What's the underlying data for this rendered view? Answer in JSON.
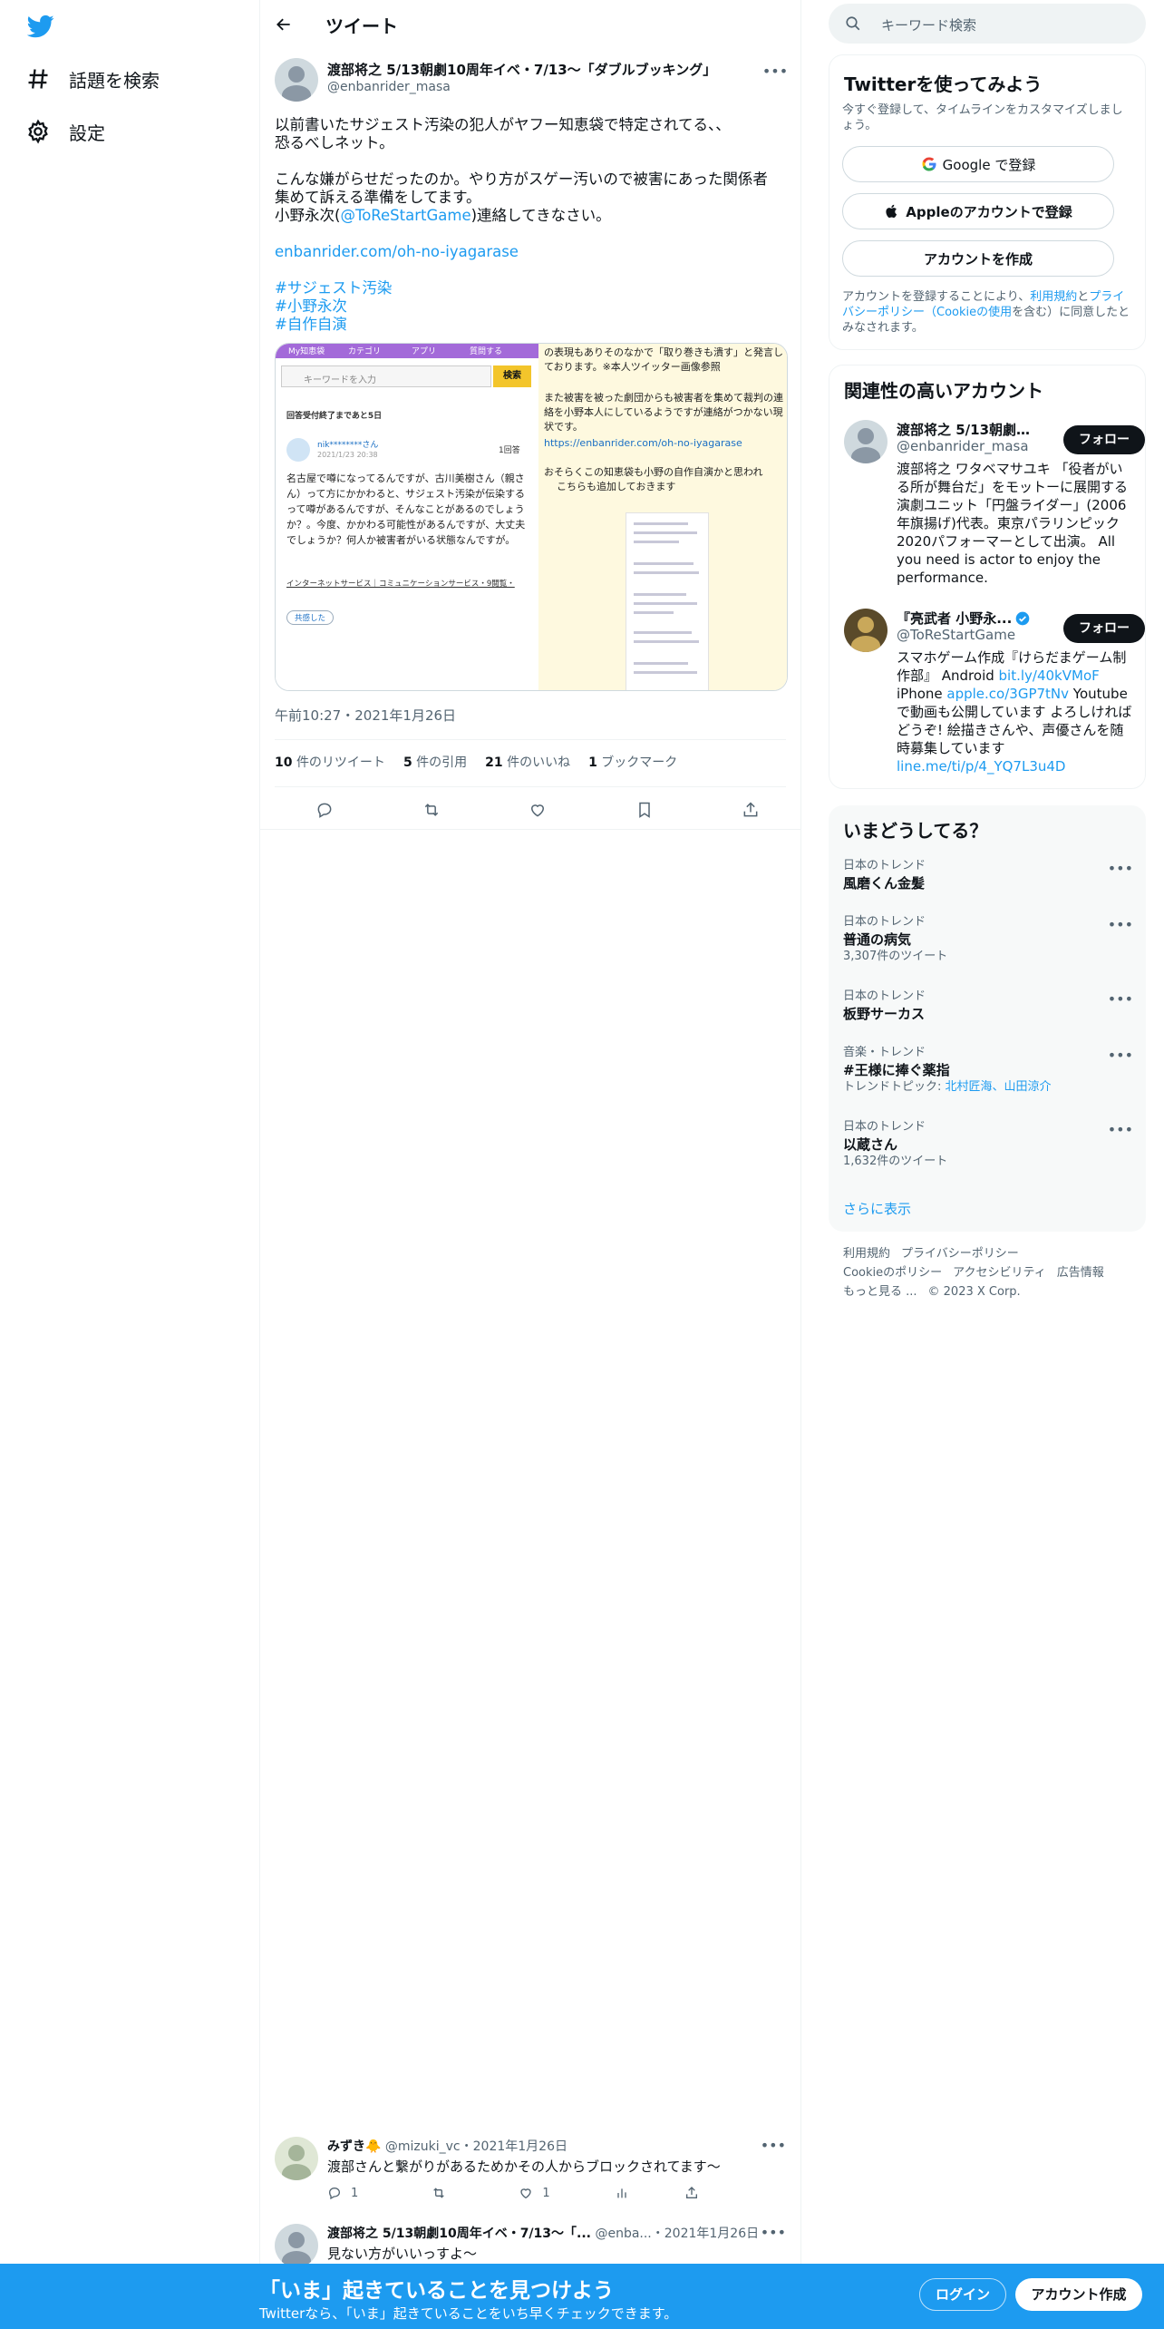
{
  "nav": {
    "explore_label": "話題を検索",
    "settings_label": "設定"
  },
  "header": {
    "title": "ツイート"
  },
  "tweet": {
    "author_name": "渡部将之 5/13朝劇10周年イベ・7/13〜「ダブルブッキング」",
    "author_handle": "@enbanrider_masa",
    "text_line1": "以前書いたサジェスト汚染の犯人がヤフー知恵袋で特定されてる、、",
    "text_line2": "恐るべしネット。",
    "text_line3": "こんな嫌がらせだったのか。やり方がスゲー汚いので被害にあった関係者",
    "text_line4": "集めて訴える準備をしてます。",
    "text_line5_prefix": "小野永次(",
    "text_line5_mention": "@ToReStartGame",
    "text_line5_suffix": ")連絡してきなさい。",
    "link": "enbanrider.com/oh-no-iyagarase",
    "hashtags": [
      "#サジェスト汚染",
      "#小野永次",
      "#自作自演"
    ],
    "timestamp": "午前10:27・2021年1月26日",
    "stats": {
      "retweets_count": "10",
      "retweets_label": "件のリツイート",
      "quotes_count": "5",
      "quotes_label": "件の引用",
      "likes_count": "21",
      "likes_label": "件のいいね",
      "bookmarks_count": "1",
      "bookmarks_label": "ブックマーク"
    },
    "media": {
      "left": {
        "tabs": [
          "My知恵袋",
          "カテゴリ",
          "アプリ",
          "質問する"
        ],
        "search_placeholder": "キーワードを入力",
        "search_button": "検索",
        "deadline": "回答受付終了まであと5日",
        "user": "nik********さん",
        "date": "2021/1/23 20:38",
        "answers": "1回答",
        "body": "名古屋で噂になってるんですが、古川美樹さん（親さん）って方にかかわると、サジェスト汚染が伝染するって噂があるんですが、そんなことがあるのでしょうか？。今度、かかわる可能性があるんですが、大丈夫でしょうか？何人か被害者がいる状態なんですが。",
        "categories": "インターネットサービス｜コミュニケーションサービス・9閲覧・",
        "share": "共感した"
      },
      "right": {
        "para1": "の表現もありそのなかで「取り巻きも潰す」と発言しております。※本人ツイッター画像参照",
        "para2": "また被害を被った劇団からも被害者を集めて裁判の連絡を小野本人にしているようですが連絡がつかない現状です。",
        "link": "https://enbanrider.com/oh-no-iyagarase",
        "para3": "おそらくこの知恵袋も小野の自作自演かと思われ",
        "para4": "こちらも追加しておきます"
      }
    }
  },
  "replies": [
    {
      "name": "みずき🐥",
      "handle": "@mizuki_vc",
      "date": "・2021年1月26日",
      "text": "渡部さんと繋がりがあるためかその人からブロックされてます～",
      "reply_count": "1",
      "retweet_count": "",
      "like_count": "1"
    },
    {
      "name": "渡部将之 5/13朝劇10周年イベ・7/13〜「...",
      "handle": "@enba...",
      "date": "・2021年1月26日",
      "text": "見ない方がいいっすよ～"
    }
  ],
  "sidebar": {
    "search_placeholder": "キーワード検索",
    "signup": {
      "title": "Twitterを使ってみよう",
      "subtitle": "今すぐ登録して、タイムラインをカスタマイズしましょう。",
      "google": "Google で登録",
      "apple": "Appleのアカウントで登録",
      "create": "アカウントを作成",
      "legal_1": "アカウントを登録することにより、",
      "legal_terms": "利用規約",
      "legal_2": "と",
      "legal_privacy": "プライバシーポリシー（Cookieの使用",
      "legal_3": "を含む）に同意したとみなされます。"
    },
    "related": {
      "title": "関連性の高いアカウント",
      "accounts": [
        {
          "name": "渡部将之 5/13朝劇10...",
          "handle": "@enbanrider_masa",
          "bio": "渡部将之 ワタベマサユキ 「役者がいる所が舞台だ」をモットーに展開する演劇ユニット「円盤ライダー」(2006年旗揚げ)代表。東京パラリンピック2020パフォーマーとして出演。 All you need is actor to enjoy the performance.",
          "follow": "フォロー"
        },
        {
          "name": "『亮武者 小野永...",
          "handle": "@ToReStartGame",
          "bio_1": "スマホゲーム作成『けらだまゲーム制作部』 Android ",
          "bio_link1": "bit.ly/40kVMoF",
          "bio_2": " iPhone ",
          "bio_link2": "apple.co/3GP7tNv",
          "bio_3": " Youtubeで動画も公開しています よろしければどうぞ! 絵描きさんや、声優さんを随時募集しています ",
          "bio_link3": "line.me/ti/p/4_YQ7L3u4D",
          "follow": "フォロー"
        }
      ]
    },
    "trends": {
      "title": "いまどうしてる？",
      "items": [
        {
          "context": "日本のトレンド",
          "name": "風磨くん金髪",
          "count": ""
        },
        {
          "context": "日本のトレンド",
          "name": "普通の病気",
          "count": "3,307件のツイート"
        },
        {
          "context": "日本のトレンド",
          "name": "板野サーカス",
          "count": ""
        },
        {
          "context": "音楽・トレンド",
          "name": "#王様に捧ぐ薬指",
          "count_prefix": "トレンドトピック: ",
          "count_links": "北村匠海、山田涼介"
        },
        {
          "context": "日本のトレンド",
          "name": "以蔵さん",
          "count": "1,632件のツイート"
        }
      ],
      "more": "さらに表示"
    },
    "footer": {
      "terms": "利用規約",
      "privacy": "プライバシーポリシー",
      "cookie": "Cookieのポリシー",
      "accessibility": "アクセシビリティ",
      "ads": "広告情報",
      "more": "もっと見る ...",
      "copyright": "© 2023 X Corp."
    }
  },
  "bottom_bar": {
    "title": "「いま」起きていることを見つけよう",
    "subtitle": "Twitterなら、「いま」起きていることをいち早くチェックできます。",
    "login": "ログイン",
    "signup": "アカウント作成"
  },
  "colors": {
    "accent": "#1d9bf0",
    "text": "#0f1419",
    "muted": "#536471",
    "border": "#eff3f4"
  }
}
